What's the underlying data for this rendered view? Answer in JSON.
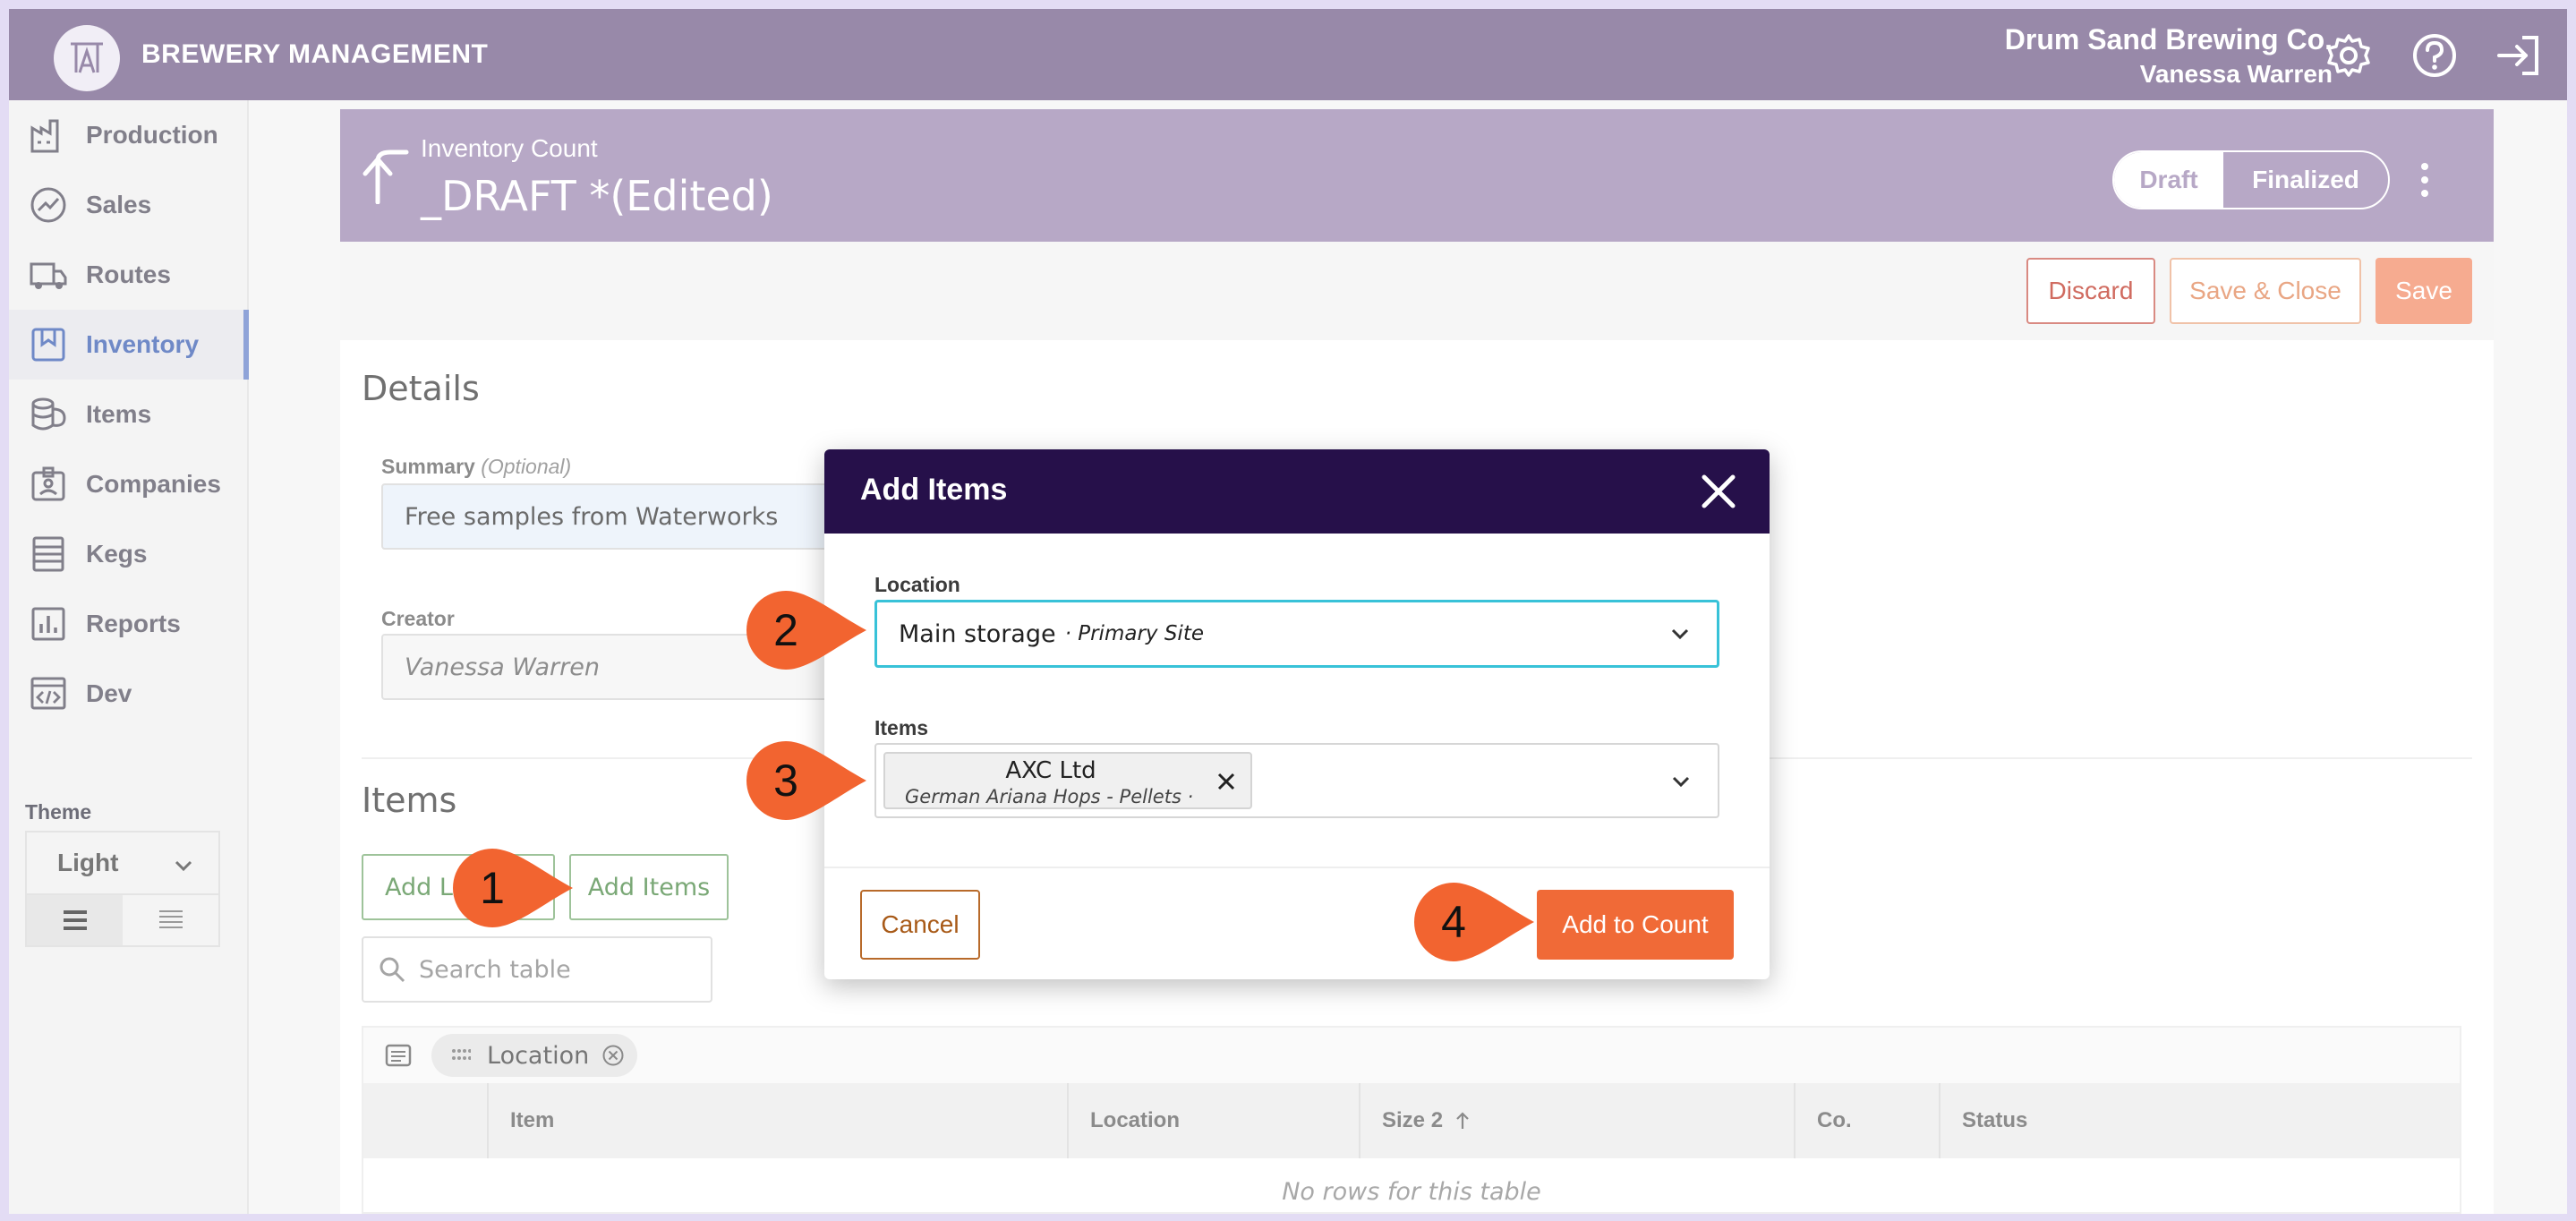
{
  "app": {
    "title": "BREWERY MANAGEMENT",
    "company": "Drum Sand Brewing Co.",
    "user": "Vanessa Warren"
  },
  "top_icons": [
    "gear-icon",
    "help-icon",
    "logout-icon"
  ],
  "sidebar": {
    "items": [
      {
        "label": "Production",
        "icon": "factory-icon"
      },
      {
        "label": "Sales",
        "icon": "trend-icon"
      },
      {
        "label": "Routes",
        "icon": "truck-icon"
      },
      {
        "label": "Inventory",
        "icon": "bookmark-icon",
        "active": true
      },
      {
        "label": "Items",
        "icon": "barrel-icon"
      },
      {
        "label": "Companies",
        "icon": "badge-icon"
      },
      {
        "label": "Kegs",
        "icon": "keg-icon"
      },
      {
        "label": "Reports",
        "icon": "bar-chart-icon"
      },
      {
        "label": "Dev",
        "icon": "code-window-icon"
      }
    ],
    "theme_label": "Theme",
    "theme_value": "Light"
  },
  "header": {
    "subtitle": "Inventory Count",
    "title": "_DRAFT *(Edited)",
    "status_options": [
      "Draft",
      "Finalized"
    ],
    "status_selected": "Draft"
  },
  "toolbar": {
    "discard": "Discard",
    "save_close": "Save & Close",
    "save": "Save"
  },
  "details": {
    "title": "Details",
    "summary_label": "Summary",
    "summary_optional": "(Optional)",
    "summary_value": "Free samples from Waterworks",
    "creator_label": "Creator",
    "creator_value": "Vanessa Warren"
  },
  "items_section": {
    "title": "Items",
    "add_location_btn": "Add L",
    "add_items_btn": "Add Items",
    "search_placeholder": "Search table",
    "group_chip": "Location",
    "columns": [
      "Item",
      "Location",
      "Size 2",
      "Co.",
      "Status"
    ],
    "empty_text": "No rows for this table"
  },
  "modal": {
    "title": "Add Items",
    "location_label": "Location",
    "location_value": "Main storage",
    "location_sub": "· Primary Site",
    "items_label": "Items",
    "item_tag_title": "AXC Ltd",
    "item_tag_sub": "German Ariana Hops - Pellets ·",
    "cancel": "Cancel",
    "add_to_count": "Add to Count"
  },
  "callouts": [
    "1",
    "2",
    "3",
    "4"
  ],
  "colors": {
    "topbar": "#9889a9",
    "card_header": "#b7a8c6",
    "modal_header": "#26104a",
    "primary_action": "#f06a37",
    "callout": "#f26430",
    "focus": "#38c2d8"
  }
}
